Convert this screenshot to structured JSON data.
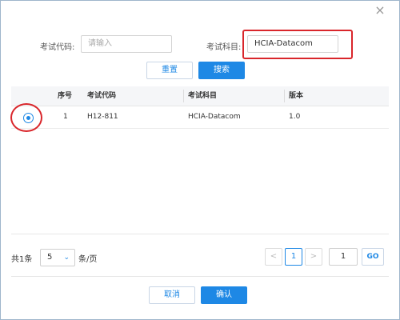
{
  "dialog": {
    "close_glyph": "×"
  },
  "filters": {
    "exam_code_label": "考试代码:",
    "exam_code_placeholder": "请输入",
    "subject_label": "考试科目:",
    "subject_value": "HCIA-Datacom",
    "reset_label": "重置",
    "search_label": "搜索"
  },
  "table": {
    "columns": [
      "序号",
      "考试代码",
      "考试科目",
      "版本"
    ],
    "rows": [
      {
        "index": "1",
        "code": "H12-811",
        "subject": "HCIA-Datacom",
        "version": "1.0",
        "selected": true
      }
    ]
  },
  "pagination": {
    "total_text": "共1条",
    "page_size": "5",
    "page_size_suffix": "条/页",
    "prev_glyph": "<",
    "current_page": "1",
    "next_glyph": ">",
    "goto_value": "1",
    "go_label": "GO"
  },
  "footer": {
    "cancel_label": "取消",
    "confirm_label": "确认"
  },
  "colors": {
    "accent": "#1e88e5",
    "highlight": "#d9262b"
  }
}
